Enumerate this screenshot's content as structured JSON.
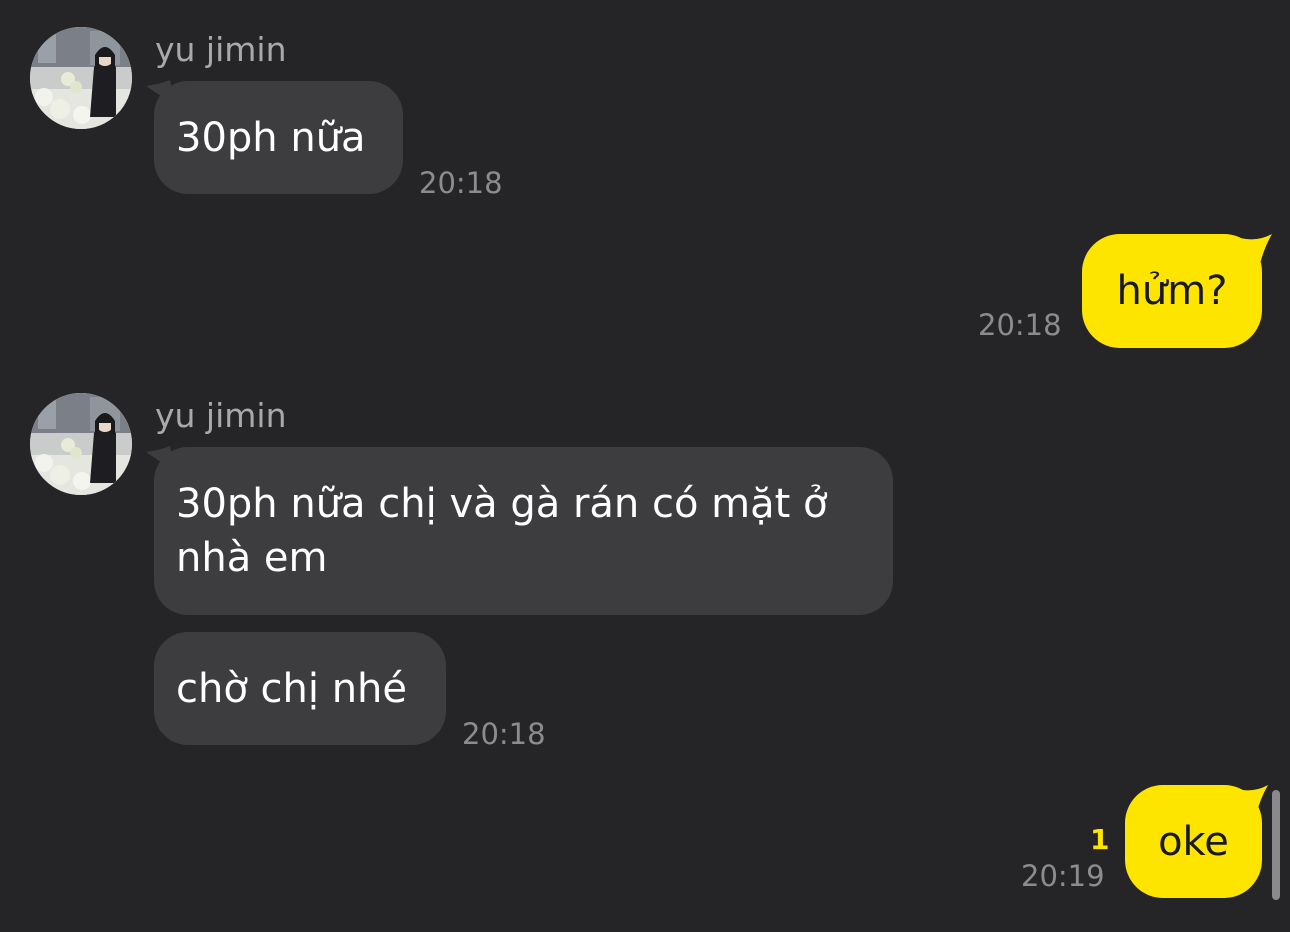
{
  "contact": {
    "name": "yu jimin"
  },
  "colors": {
    "background": "#252527",
    "incoming_bubble": "#3d3d3f",
    "outgoing_bubble": "#fee500",
    "unread": "#fee500"
  },
  "messages": [
    {
      "direction": "incoming",
      "sender": "yu jimin",
      "text": "30ph nữa",
      "time": "20:18"
    },
    {
      "direction": "outgoing",
      "text": "hửm?",
      "time": "20:18"
    },
    {
      "direction": "incoming",
      "sender": "yu jimin",
      "text": "30ph nữa chị và gà rán có mặt ở nhà em",
      "time": ""
    },
    {
      "direction": "incoming",
      "text": "chờ chị nhé",
      "time": "20:18"
    },
    {
      "direction": "outgoing",
      "text": "oke",
      "time": "20:19",
      "unread": "1"
    }
  ]
}
